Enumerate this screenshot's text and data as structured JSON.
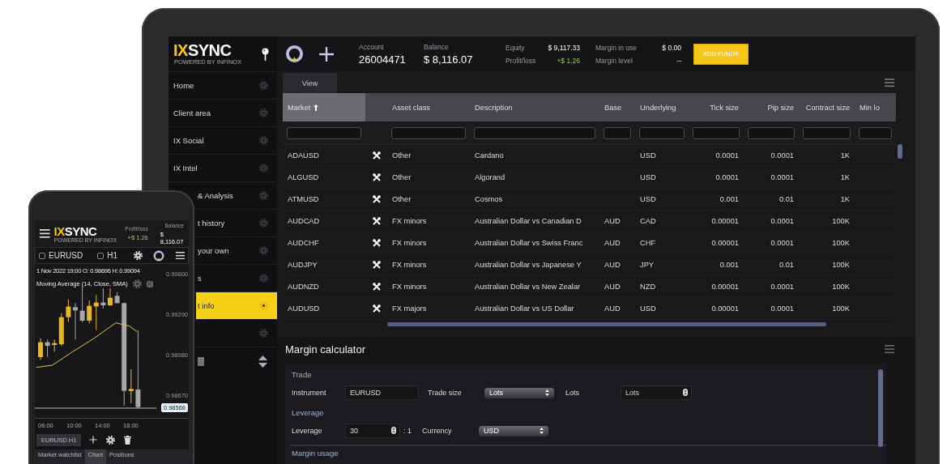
{
  "desktop": {
    "logo": {
      "accent": "IX",
      "name": "SYNC",
      "tagline": "POWERED BY INFINOX"
    },
    "sidebar": {
      "items": [
        {
          "label": "Home",
          "selected": false
        },
        {
          "label": "Client area",
          "selected": false
        },
        {
          "label": "IX Social",
          "selected": false
        },
        {
          "label": "IX Intel",
          "selected": false
        },
        {
          "label": "& Analysis",
          "selected": false
        },
        {
          "label": "t history",
          "selected": false
        },
        {
          "label": "your own",
          "selected": false
        },
        {
          "label": "s",
          "selected": false
        },
        {
          "label": "t info",
          "selected": true
        },
        {
          "selected": false
        }
      ]
    },
    "top_bar": {
      "account_label": "Account",
      "account": "26004471",
      "balance_label": "Balance",
      "balance": "$ 8,116.07",
      "equity_label": "Equity",
      "equity": "$ 9,117.33",
      "pl_label": "Profit/loss",
      "pl": "+$ 1.26",
      "margin_in_use_label": "Margin in use",
      "margin_in_use": "$ 0.00",
      "margin_level_label": "Margin level",
      "margin_level": "--",
      "add_funds": "ADD FUNDS"
    },
    "tabs": [
      {
        "label": "View",
        "selected": true
      }
    ],
    "table": {
      "columns": [
        {
          "label": "Market",
          "sorted": true
        },
        {
          "label": "Asset class",
          "sorted": false
        },
        {
          "label": "Description",
          "sorted": false
        },
        {
          "label": "Base",
          "sorted": false
        },
        {
          "label": "Underlying",
          "sorted": false
        },
        {
          "label": "Tick size",
          "sorted": false
        },
        {
          "label": "Pip size",
          "sorted": false
        },
        {
          "label": "Contract size",
          "sorted": false
        },
        {
          "label": "Min lo",
          "sorted": false
        }
      ],
      "rows": [
        {
          "market": "ADAUSD",
          "asset_class": "Other",
          "description": "Cardano",
          "underlying": "USD",
          "tick_size": "0.0001",
          "pip_size": "0.0001",
          "contract_size": "1K"
        },
        {
          "market": "ALGUSD",
          "asset_class": "Other",
          "description": "Algorand",
          "underlying": "USD",
          "tick_size": "0.0001",
          "pip_size": "0.0001",
          "contract_size": "1K"
        },
        {
          "market": "ATMUSD",
          "asset_class": "Other",
          "description": "Cosmos",
          "underlying": "USD",
          "tick_size": "0.001",
          "pip_size": "0.01",
          "contract_size": "1K"
        },
        {
          "market": "AUDCAD",
          "asset_class": "FX minors",
          "description": "Australian Dollar vs Canadian D",
          "base": "AUD",
          "underlying": "CAD",
          "tick_size": "0.00001",
          "pip_size": "0.0001",
          "contract_size": "100K"
        },
        {
          "market": "AUDCHF",
          "asset_class": "FX minors",
          "description": "Australian Dollar vs Swiss Franc",
          "base": "AUD",
          "underlying": "CHF",
          "tick_size": "0.00001",
          "pip_size": "0.0001",
          "contract_size": "100K"
        },
        {
          "market": "AUDJPY",
          "asset_class": "FX minors",
          "description": "Australian Dollar vs Japanese Y",
          "base": "AUD",
          "underlying": "JPY",
          "tick_size": "0.001",
          "pip_size": "0.01",
          "contract_size": "100K"
        },
        {
          "market": "AUDNZD",
          "asset_class": "FX minors",
          "description": "Australian Dollar vs New Zealar",
          "base": "AUD",
          "underlying": "NZD",
          "tick_size": "0.00001",
          "pip_size": "0.0001",
          "contract_size": "100K"
        },
        {
          "market": "AUDUSD",
          "asset_class": "FX majors",
          "description": "Australian Dollar vs US Dollar",
          "base": "AUD",
          "underlying": "USD",
          "tick_size": "0.00001",
          "pip_size": "0.0001",
          "contract_size": "100K"
        }
      ]
    },
    "margin_calculator": {
      "title": "Margin calculator",
      "trade_heading": "Trade",
      "instrument_label": "Instrument",
      "instrument": "EURUSD",
      "trade_size_label": "Trade size",
      "trade_size": "Lots",
      "lots_label": "Lots",
      "lots_placeholder": "Lots",
      "leverage_heading": "Leverage",
      "leverage_label": "Leverage",
      "leverage": "30",
      "leverage_suffix": ": 1",
      "currency_label": "Currency",
      "currency": "USD",
      "margin_usage_heading": "Margin usage"
    }
  },
  "phone": {
    "logo": {
      "accent": "IX",
      "name": "SYNC",
      "tagline": "POWERED BY INFINOX"
    },
    "pl_label": "Profit/loss",
    "pl": "+$ 1.26",
    "balance_label": "Balance",
    "balance": "$ 8,116.07",
    "symbol": {
      "label": "EURUSD",
      "checked": false
    },
    "timeframe": {
      "label": "H1",
      "checked": false
    },
    "chart": {
      "info": "1 Nov 2022 19:00  O: 0.98696  H: 0.99094",
      "indicator": "Moving Average (14, Close, SMA)",
      "price_labels": [
        "0.99600",
        "0.99290",
        "0.98980",
        "0.98670"
      ],
      "current_price": "0.98566",
      "time_labels": [
        "06:00",
        "10:00",
        "14:00",
        "18:00"
      ]
    },
    "chart_tabs": [
      {
        "label": "EURUSD H1",
        "selected": true
      }
    ],
    "bottom_tabs": [
      {
        "label": "Market watchlist",
        "selected": false
      },
      {
        "label": "Chart",
        "selected": true
      },
      {
        "label": "Positions",
        "selected": false
      }
    ]
  }
}
